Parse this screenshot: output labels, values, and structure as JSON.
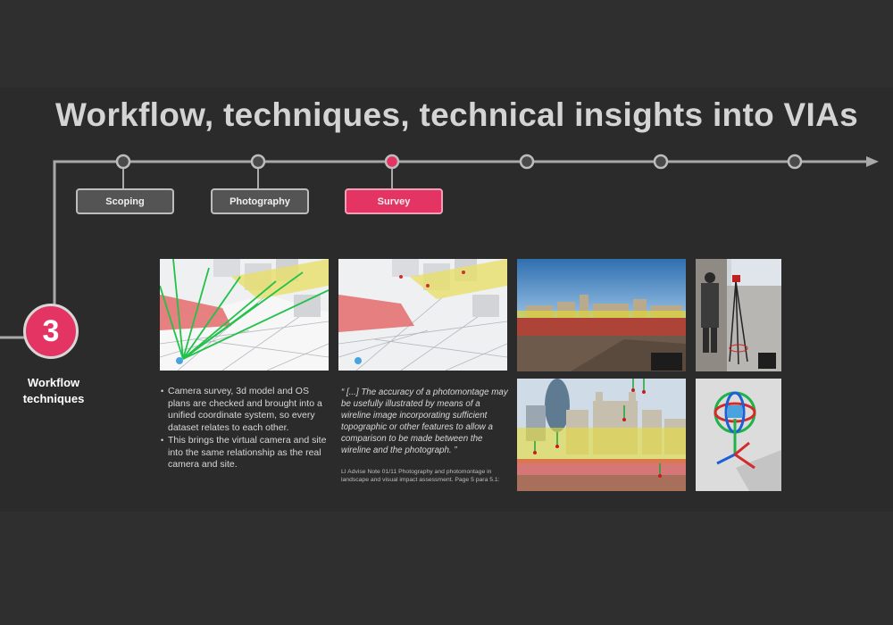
{
  "header": {
    "title": "Workflow, techniques, technical insights into VIAs"
  },
  "timeline": {
    "stages": [
      {
        "label": "Scoping",
        "active": false
      },
      {
        "label": "Photography",
        "active": false
      },
      {
        "label": "Survey",
        "active": true
      }
    ],
    "accent_color": "#e43463"
  },
  "step": {
    "number": "3",
    "label_line1": "Workflow",
    "label_line2": "techniques"
  },
  "content": {
    "bullets": [
      "Camera survey, 3d model and OS plans are checked and brought into a unified coordinate system, so every dataset relates to each other.",
      "This brings the virtual camera and site into the same relationship as the real camera and site."
    ],
    "quote": "“ [...] The accuracy of a photomontage may be usefully illustrated by means of a wireline image incorporating sufficient topographic or other features to allow a comparison to be made between the wireline and the photograph. ”",
    "citation": "LI Advise Note 01/11 Photography and photomontage in landscape and visual impact assessment. Page 5 para 5.1:"
  }
}
